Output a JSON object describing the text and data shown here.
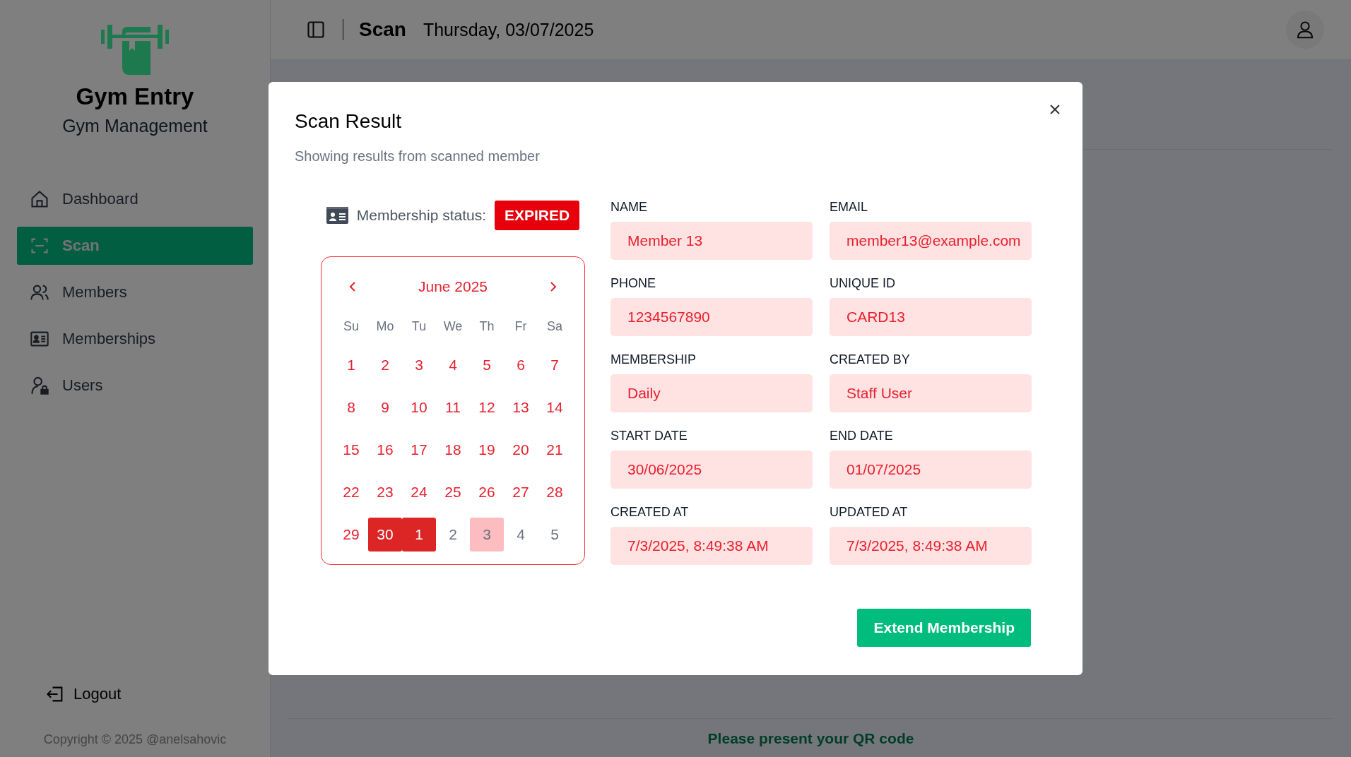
{
  "sidebar": {
    "title": "Gym Entry",
    "subtitle": "Gym Management",
    "items": [
      {
        "label": "Dashboard",
        "kind": "home",
        "selected": false
      },
      {
        "label": "Scan",
        "kind": "scan",
        "selected": true
      },
      {
        "label": "Members",
        "kind": "users",
        "selected": false
      },
      {
        "label": "Memberships",
        "kind": "card",
        "selected": false
      },
      {
        "label": "Users",
        "kind": "user-lock",
        "selected": false
      }
    ],
    "logout": "Logout",
    "copyright": "Copyright © 2025 @anelsahovic"
  },
  "header": {
    "title": "Scan",
    "date": "Thursday, 03/07/2025"
  },
  "page": {
    "message": "Please present your QR code"
  },
  "modal": {
    "title": "Scan Result",
    "subtitle": "Showing results from scanned member",
    "status_label": "Membership status:",
    "status": "EXPIRED",
    "calendar": {
      "month": "June 2025",
      "weekdays": [
        "Su",
        "Mo",
        "Tu",
        "We",
        "Th",
        "Fr",
        "Sa"
      ],
      "weeks": [
        [
          {
            "day": "1",
            "kind": "in",
            "in_range": false,
            "today": false
          },
          {
            "day": "2",
            "kind": "in",
            "in_range": false,
            "today": false
          },
          {
            "day": "3",
            "kind": "in",
            "in_range": false,
            "today": false
          },
          {
            "day": "4",
            "kind": "in",
            "in_range": false,
            "today": false
          },
          {
            "day": "5",
            "kind": "in",
            "in_range": false,
            "today": false
          },
          {
            "day": "6",
            "kind": "in",
            "in_range": false,
            "today": false
          },
          {
            "day": "7",
            "kind": "in",
            "in_range": false,
            "today": false
          }
        ],
        [
          {
            "day": "8",
            "kind": "in",
            "in_range": false,
            "today": false
          },
          {
            "day": "9",
            "kind": "in",
            "in_range": false,
            "today": false
          },
          {
            "day": "10",
            "kind": "in",
            "in_range": false,
            "today": false
          },
          {
            "day": "11",
            "kind": "in",
            "in_range": false,
            "today": false
          },
          {
            "day": "12",
            "kind": "in",
            "in_range": false,
            "today": false
          },
          {
            "day": "13",
            "kind": "in",
            "in_range": false,
            "today": false
          },
          {
            "day": "14",
            "kind": "in",
            "in_range": false,
            "today": false
          }
        ],
        [
          {
            "day": "15",
            "kind": "in",
            "in_range": false,
            "today": false
          },
          {
            "day": "16",
            "kind": "in",
            "in_range": false,
            "today": false
          },
          {
            "day": "17",
            "kind": "in",
            "in_range": false,
            "today": false
          },
          {
            "day": "18",
            "kind": "in",
            "in_range": false,
            "today": false
          },
          {
            "day": "19",
            "kind": "in",
            "in_range": false,
            "today": false
          },
          {
            "day": "20",
            "kind": "in",
            "in_range": false,
            "today": false
          },
          {
            "day": "21",
            "kind": "in",
            "in_range": false,
            "today": false
          }
        ],
        [
          {
            "day": "22",
            "kind": "in",
            "in_range": false,
            "today": false
          },
          {
            "day": "23",
            "kind": "in",
            "in_range": false,
            "today": false
          },
          {
            "day": "24",
            "kind": "in",
            "in_range": false,
            "today": false
          },
          {
            "day": "25",
            "kind": "in",
            "in_range": false,
            "today": false
          },
          {
            "day": "26",
            "kind": "in",
            "in_range": false,
            "today": false
          },
          {
            "day": "27",
            "kind": "in",
            "in_range": false,
            "today": false
          },
          {
            "day": "28",
            "kind": "in",
            "in_range": false,
            "today": false
          }
        ],
        [
          {
            "day": "29",
            "kind": "in",
            "in_range": false,
            "today": false
          },
          {
            "day": "30",
            "kind": "in",
            "in_range": true,
            "today": false
          },
          {
            "day": "1",
            "kind": "out",
            "in_range": true,
            "today": false
          },
          {
            "day": "2",
            "kind": "out",
            "in_range": false,
            "today": false
          },
          {
            "day": "3",
            "kind": "out",
            "in_range": false,
            "today": true
          },
          {
            "day": "4",
            "kind": "out",
            "in_range": false,
            "today": false
          },
          {
            "day": "5",
            "kind": "out",
            "in_range": false,
            "today": false
          }
        ]
      ]
    },
    "fields": [
      {
        "label": "NAME",
        "value": "Member 13"
      },
      {
        "label": "EMAIL",
        "value": "member13@example.com"
      },
      {
        "label": "PHONE",
        "value": "1234567890"
      },
      {
        "label": "UNIQUE ID",
        "value": "CARD13"
      },
      {
        "label": "MEMBERSHIP",
        "value": "Daily"
      },
      {
        "label": "CREATED BY",
        "value": "Staff User"
      },
      {
        "label": "START DATE",
        "value": "30/06/2025"
      },
      {
        "label": "END DATE",
        "value": "01/07/2025"
      },
      {
        "label": "CREATED AT",
        "value": "7/3/2025, 8:49:38 AM"
      },
      {
        "label": "UPDATED AT",
        "value": "7/3/2025, 8:49:38 AM"
      }
    ],
    "action": "Extend Membership"
  }
}
